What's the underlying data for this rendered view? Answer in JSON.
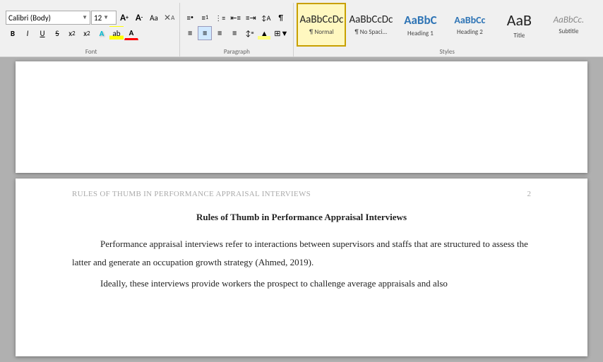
{
  "ribbon": {
    "font_section": {
      "label": "Font",
      "font_name": "Calibri (Body)",
      "font_size": "12",
      "grow_icon": "A↑",
      "shrink_icon": "A↓",
      "case_icon": "Aa",
      "clear_icon": "✕",
      "bold": "B",
      "italic": "I",
      "underline": "U",
      "strikethrough": "S",
      "subscript": "x₂",
      "superscript": "x²",
      "text_effect": "A",
      "highlight": "ab",
      "font_color": "A"
    },
    "paragraph_section": {
      "label": "Paragraph",
      "bullets": "≡•",
      "numbering": "≡1",
      "multilevel": "≡↕",
      "decrease_indent": "←≡",
      "increase_indent": "→≡",
      "sort": "↕A",
      "pilcrow": "¶",
      "align_left": "≡",
      "align_center": "≡",
      "align_right": "≡",
      "justify": "≡",
      "line_spacing": "↕",
      "shading": "▲",
      "borders": "□"
    },
    "styles_section": {
      "label": "Styles",
      "items": [
        {
          "id": "normal",
          "label": "¶ Normal",
          "preview": "AaBbCcDc",
          "selected": true,
          "font_size": 14
        },
        {
          "id": "no-spacing",
          "label": "¶ No Spaci...",
          "preview": "AaBbCcDc",
          "selected": false,
          "font_size": 14
        },
        {
          "id": "heading1",
          "label": "Heading 1",
          "preview": "AaBbC",
          "selected": false,
          "font_size": 16,
          "color": "#2e74b5"
        },
        {
          "id": "heading2",
          "label": "Heading 2",
          "preview": "AaBbCc",
          "selected": false,
          "font_size": 14,
          "color": "#2e74b5"
        },
        {
          "id": "title",
          "label": "Title",
          "preview": "AaB",
          "selected": false,
          "font_size": 22
        },
        {
          "id": "subtitle",
          "label": "Subtitle",
          "preview": "AaBbCc.",
          "selected": false,
          "font_size": 13,
          "color": "#888"
        }
      ]
    }
  },
  "document": {
    "pages": [
      {
        "id": "page1",
        "content": ""
      },
      {
        "id": "page2",
        "header_title": "RULES OF THUMB IN PERFORMANCE APPRAISAL INTERVIEWS",
        "header_page": "2",
        "title": "Rules of Thumb in Performance Appraisal Interviews",
        "paragraphs": [
          "Performance appraisal interviews refer to interactions between supervisors and staffs that are structured to assess the latter and generate an occupation growth strategy (Ahmed, 2019).",
          "Ideally, these interviews provide workers the prospect to challenge average appraisals and also"
        ]
      }
    ]
  }
}
